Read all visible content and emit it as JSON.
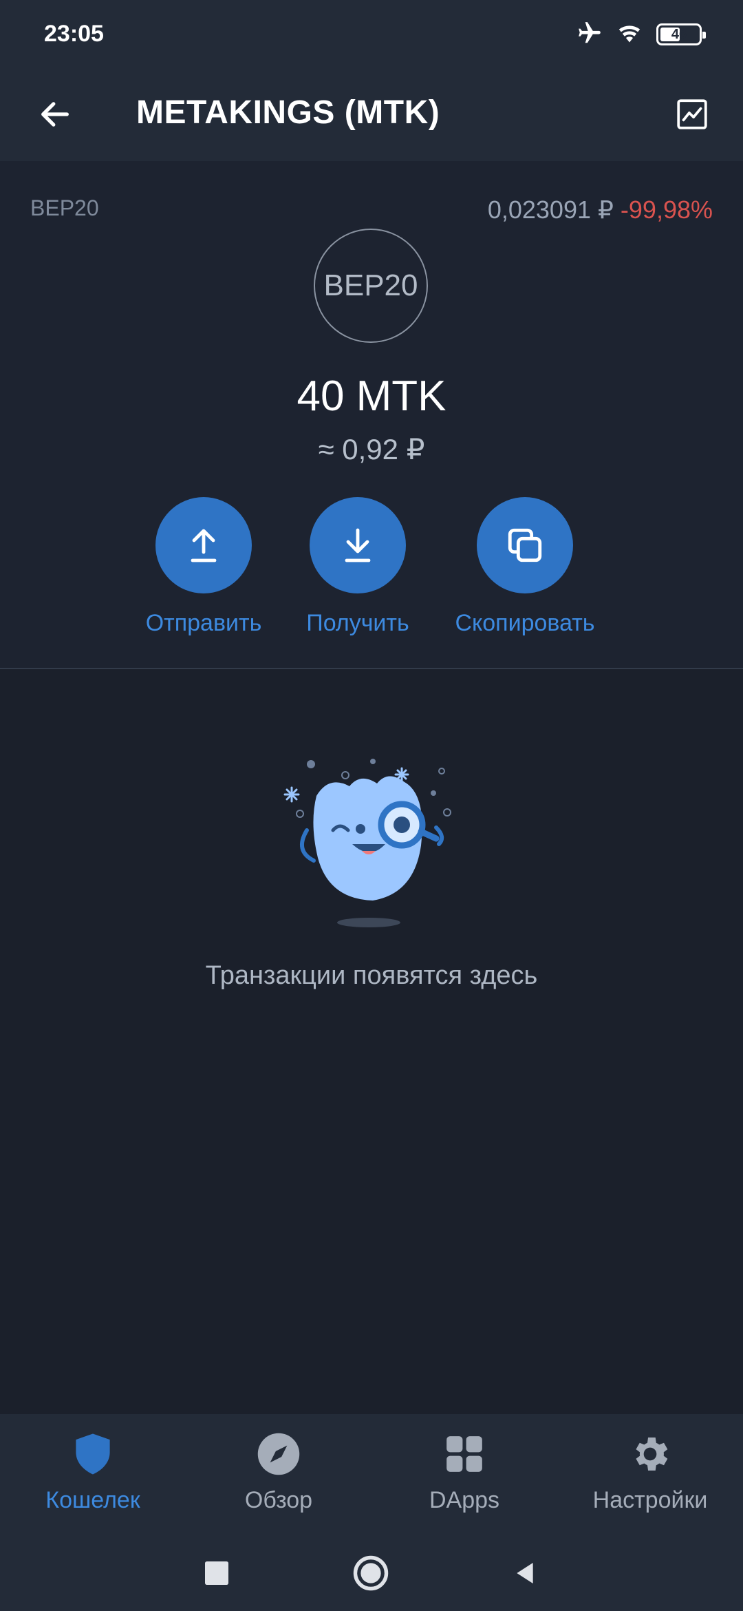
{
  "status_bar": {
    "time": "23:05",
    "battery": "46",
    "icons": [
      "airplane-icon",
      "wifi-icon",
      "battery-icon"
    ]
  },
  "app_bar": {
    "title": "METAKINGS (MTK)",
    "back_icon": "arrow-left-icon",
    "chart_icon": "chart-icon"
  },
  "token": {
    "network": "BEP20",
    "price": "0,023091 ₽",
    "change": "-99,98%",
    "logo_text": "BEP20",
    "balance": "40 MTK",
    "fiat_balance": "≈ 0,92 ₽"
  },
  "actions": [
    {
      "label": "Отправить",
      "icon": "upload-icon"
    },
    {
      "label": "Получить",
      "icon": "download-icon"
    },
    {
      "label": "Скопировать",
      "icon": "copy-icon"
    }
  ],
  "empty_state": {
    "text": "Транзакции появятся здесь",
    "illustration": "magnifier-mascot-illustration"
  },
  "bottom_nav": [
    {
      "label": "Кошелек",
      "icon": "shield-icon",
      "active": true
    },
    {
      "label": "Обзор",
      "icon": "compass-icon",
      "active": false
    },
    {
      "label": "DApps",
      "icon": "grid-icon",
      "active": false
    },
    {
      "label": "Настройки",
      "icon": "gear-icon",
      "active": false
    }
  ],
  "colors": {
    "accent": "#2f74c5",
    "accent_text": "#3d8ae0",
    "negative": "#d9534f",
    "background": "#1b202b",
    "bar": "#232b38"
  }
}
